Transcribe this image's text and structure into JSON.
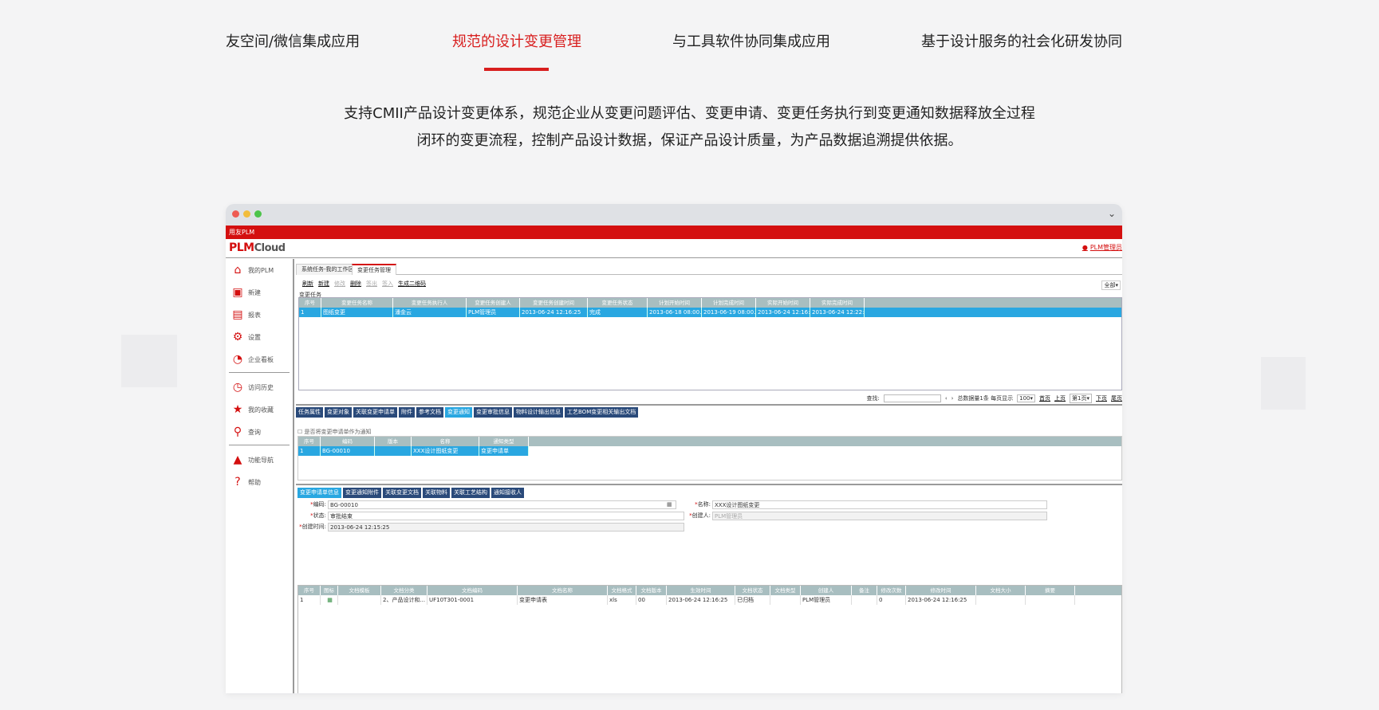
{
  "tabs": [
    {
      "label": "友空间/微信集成应用",
      "active": false
    },
    {
      "label": "规范的设计变更管理",
      "active": true
    },
    {
      "label": "与工具软件协同集成应用",
      "active": false
    },
    {
      "label": "基于设计服务的社会化研发协同",
      "active": false
    }
  ],
  "description": {
    "line1": "支持CMII产品设计变更体系，规范企业从变更问题评估、变更申请、变更任务执行到变更通知数据释放全过程",
    "line2": "闭环的变更流程，控制产品设计数据，保证产品设计质量，为产品数据追溯提供依据。"
  },
  "colors": {
    "accent": "#d81e1e",
    "appRed": "#d40f0f",
    "gridHeader": "#a8bec0",
    "selectedRow": "#29a7e1",
    "tabNavy": "#2a4a7a"
  },
  "app": {
    "topbar": "用友PLM",
    "logo_plm": "PLM",
    "logo_cloud": "Cloud",
    "user": "PLM管理员",
    "sidebar": [
      {
        "label": "我的PLM",
        "icon": "home-icon"
      },
      {
        "label": "新建",
        "icon": "new-doc-icon"
      },
      {
        "label": "报表",
        "icon": "report-icon"
      },
      {
        "label": "设置",
        "icon": "gear-icon"
      },
      {
        "label": "企业看板",
        "icon": "dashboard-icon"
      },
      {
        "label": "访问历史",
        "icon": "history-icon"
      },
      {
        "label": "我的收藏",
        "icon": "star-icon"
      },
      {
        "label": "查询",
        "icon": "search-icon"
      },
      {
        "label": "功能导航",
        "icon": "navigation-icon"
      },
      {
        "label": "帮助",
        "icon": "help-icon"
      }
    ],
    "main_tabs": [
      "系统任务-我的工作区",
      "变更任务管理"
    ],
    "toolbar": [
      "刷新",
      "新建",
      "修改",
      "删除",
      "签出",
      "签入",
      "生成二维码"
    ],
    "toolbar_filter": "全部",
    "task_section": "变更任务",
    "task_headers": [
      "序号",
      "变更任务名称",
      "变更任务执行人",
      "变更任务创建人",
      "变更任务创建时间",
      "变更任务状态",
      "计划开始时间",
      "计划完成时间",
      "实际开始时间",
      "实际完成时间"
    ],
    "task_rows": [
      [
        "1",
        "图纸变更",
        "潘金云",
        "PLM管理员",
        "2013-06-24 12:16:25",
        "完成",
        "2013-06-18 08:00...",
        "2013-06-19 08:00...",
        "2013-06-24 12:16:...",
        "2013-06-24 12:22:..."
      ]
    ],
    "pager": {
      "find_label": "查找:",
      "summary": "总数据量1条 每页显示",
      "page_size": "100",
      "first": "首页",
      "prev": "上页",
      "page": "第1页",
      "next": "下页",
      "last": "尾页"
    },
    "detail_tabs": [
      "任务属性",
      "变更对象",
      "关联变更申请单",
      "附件",
      "参考文档",
      "变更通知",
      "变更审批信息",
      "物料设计输出信息",
      "工艺BOM变更相关输出文档"
    ],
    "detail_active_index": 5,
    "checkbox_label": "是否将变更申请单作为通知",
    "notice_headers": [
      "序号",
      "编码",
      "版本",
      "名称",
      "通知类型"
    ],
    "notice_rows": [
      [
        "1",
        "BG-00010",
        "",
        "XXX设计图纸变更",
        "变更申请单"
      ]
    ],
    "form_tabs": [
      "变更申请单信息",
      "变更通知附件",
      "关联变更文档",
      "关联物料",
      "关联工艺结构",
      "通知接收人"
    ],
    "form": {
      "code_label": "编码:",
      "code": "BG-00010",
      "name_label": "名称:",
      "name": "XXX设计图纸变更",
      "status_label": "状态:",
      "status": "审批结束",
      "creator_label": "创建人:",
      "creator": "PLM管理员",
      "created_label": "创建时间:",
      "created": "2013-06-24 12:15:25"
    },
    "doc_headers": [
      "序号",
      "图标",
      "文档模板",
      "文档分类",
      "文档编码",
      "文档名称",
      "文档格式",
      "文档版本",
      "生效时间",
      "文档状态",
      "文档类型",
      "创建人",
      "备注",
      "修改次数",
      "修改时间",
      "文档大小",
      "摘要"
    ],
    "doc_rows": [
      [
        "1",
        "",
        "",
        "2、产品设计和...",
        "UF10T301-0001",
        "变更申请表",
        "xls",
        "00",
        "2013-06-24 12:16:25",
        "已归档",
        "",
        "PLM管理员",
        "",
        "0",
        "2013-06-24 12:16:25",
        "",
        ""
      ]
    ]
  }
}
